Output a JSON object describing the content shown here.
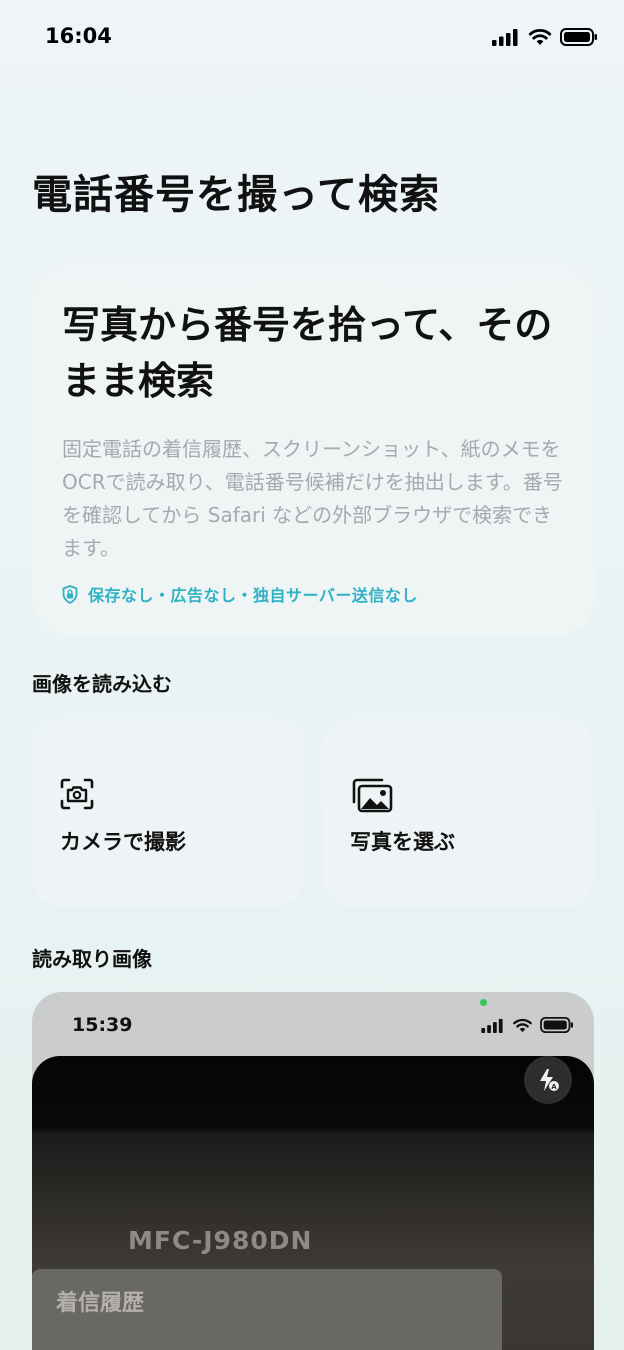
{
  "status_bar": {
    "time": "16:04"
  },
  "page_title": "電話番号を撮って検索",
  "hero": {
    "heading": "写真から番号を拾って、そのまま検索",
    "description": "固定電話の着信履歴、スクリーンショット、紙のメモをOCRで読み取り、電話番号候補だけを抽出します。番号を確認してから Safari などの外部ブラウザで検索できます。",
    "badge": "保存なし・広告なし・独自サーバー送信なし",
    "badge_icon": "lock-shield-icon"
  },
  "sections": {
    "import_label": "画像を読み込む",
    "preview_label": "読み取り画像"
  },
  "actions": {
    "camera": {
      "label": "カメラで撮影",
      "icon": "camera-viewfinder-icon"
    },
    "photos": {
      "label": "写真を選ぶ",
      "icon": "photo-stack-icon"
    }
  },
  "preview": {
    "status_time": "15:39",
    "flash_icon": "flash-auto-icon",
    "printer_model": "MFC-J980DN",
    "screen_text": "着信履歴"
  },
  "colors": {
    "accent": "#2fb2c4",
    "muted_text": "#a6a9ad"
  }
}
